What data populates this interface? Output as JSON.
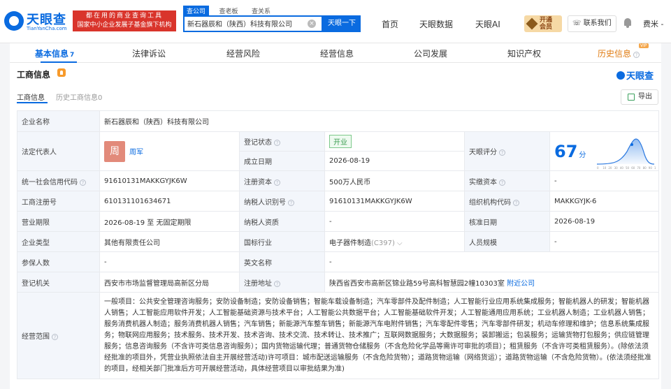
{
  "header": {
    "logo_name": "天眼查",
    "logo_domain": "TianYanCha.com",
    "slogan_line1": "都在用的商业查询工具",
    "slogan_line2": "国家中小企业发展子基金旗下机构",
    "search_tabs": [
      "查公司",
      "查老板",
      "查关系"
    ],
    "search_value": "新石器辰和（陕西）科技有限公司",
    "search_button": "天眼一下",
    "nav": [
      "首页",
      "天眼数据",
      "天眼AI"
    ],
    "vip_line1": "开通",
    "vip_line2": "会员",
    "contact": "联系我们",
    "user": "费米 -"
  },
  "main_tabs": [
    {
      "label": "基本信息",
      "count": "7"
    },
    {
      "label": "法律诉讼"
    },
    {
      "label": "经营风险"
    },
    {
      "label": "经营信息"
    },
    {
      "label": "公司发展"
    },
    {
      "label": "知识产权"
    },
    {
      "label": "历史信息",
      "tag": "VIP"
    }
  ],
  "section": {
    "title": "工商信息",
    "brand": "天眼查",
    "sub_tabs": [
      "工商信息",
      "历史工商信息0"
    ],
    "export": "导出"
  },
  "info": {
    "company_name_label": "企业名称",
    "company_name": "新石器辰和（陕西）科技有限公司",
    "legal_rep_label": "法定代表人",
    "legal_rep_avatar": "周",
    "legal_rep_name": "周军",
    "reg_status_label": "登记状态",
    "reg_status": "开业",
    "found_date_label": "成立日期",
    "found_date": "2026-08-19",
    "score_label": "天眼评分",
    "score": "67",
    "score_unit": "分",
    "credit_code_label": "统一社会信用代码",
    "credit_code": "91610131MAKKGYJK6W",
    "reg_capital_label": "注册资本",
    "reg_capital": "500万人民币",
    "paid_capital_label": "实缴资本",
    "paid_capital": "-",
    "reg_no_label": "工商注册号",
    "reg_no": "610131101634671",
    "taxpayer_label": "纳税人识别号",
    "taxpayer": "91610131MAKKGYJK6W",
    "org_code_label": "组织机构代码",
    "org_code": "MAKKGYJK-6",
    "term_label": "营业期限",
    "term": "2026-08-19 至 无固定期限",
    "taxpayer_qual_label": "纳税人资质",
    "taxpayer_qual": "-",
    "approve_date_label": "核准日期",
    "approve_date": "2026-08-19",
    "type_label": "企业类型",
    "type": "其他有限责任公司",
    "industry_label": "国标行业",
    "industry": "电子器件制造",
    "industry_code": "(C397)",
    "staff_label": "人员规模",
    "staff": "-",
    "insured_label": "参保人数",
    "insured": "-",
    "en_name_label": "英文名称",
    "en_name": "-",
    "authority_label": "登记机关",
    "authority": "西安市市场监督管理局高新区分局",
    "address_label": "注册地址",
    "address": "陕西省西安市高新区锦业路59号高科智慧园2幢10303室",
    "nearby": "附近公司",
    "scope_label": "经营范围",
    "scope": "一般项目：公共安全管理咨询服务；安防设备制造；安防设备销售；智能车载设备制造；汽车零部件及配件制造；人工智能行业应用系统集成服务；智能机器人的研发；智能机器人销售；人工智能应用软件开发；人工智能基础资源与技术平台；人工智能公共数据平台；人工智能基础软件开发；人工智能通用应用系统；工业机器人制造；工业机器人销售；服务消费机器人制造；服务消费机器人销售；汽车销售；新能源汽车整车销售；新能源汽车电附件销售；汽车零配件零售；汽车零部件研发；机动车修理和维护；信息系统集成服务；物联网应用服务；技术服务、技术开发、技术咨询、技术交流、技术转让、技术推广；互联网数据服务；大数据服务；装卸搬运；包装服务；运输货物打包服务；供应链管理服务；信息咨询服务（不含许可类信息咨询服务）；国内货物运输代理；普通货物仓储服务（不含危险化学品等需许可审批的项目）；租赁服务（不含许可类租赁服务）。(除依法须经批准的项目外，凭营业执照依法自主开展经营活动)许可项目：城市配送运输服务（不含危险货物）；道路货物运输（网络货运）；道路货物运输（不含危险货物）。(依法须经批准的项目，经相关部门批准后方可开展经营活动，具体经营项目以审批结果为准)"
  },
  "score_chart": {
    "x_ticks": [
      "0",
      "10",
      "20",
      "30",
      "40",
      "50",
      "60",
      "70",
      "80",
      "90",
      "100"
    ],
    "marker": "67"
  },
  "colors": {
    "brand": "#0a6be0",
    "slogan_bg": "#d9342b",
    "label_bg": "#f3f6fb",
    "open_green": "#3c9d52"
  }
}
